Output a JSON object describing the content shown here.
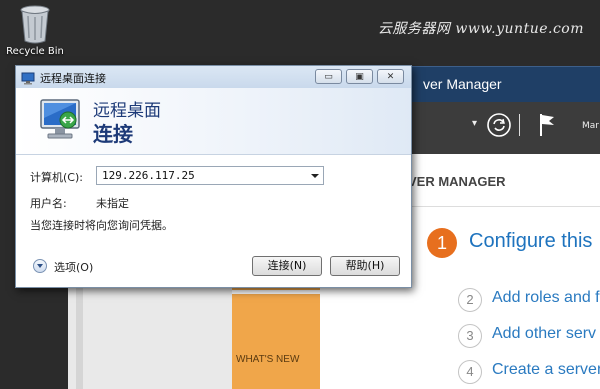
{
  "desktop": {
    "recycle_bin_label": "Recycle Bin",
    "watermark": "云服务器网 www.yuntue.com"
  },
  "server_manager": {
    "title": "ver Manager",
    "header_label": "VER MANAGER",
    "user_menu": "Mar",
    "tile_label": "WHAT'S NEW",
    "steps": [
      {
        "num": "1",
        "text": "Configure this"
      },
      {
        "num": "2",
        "text": "Add roles and f"
      },
      {
        "num": "3",
        "text": "Add other serv"
      },
      {
        "num": "4",
        "text": "Create a server"
      }
    ],
    "colors": {
      "accent": "#e76f1e",
      "title_bar": "#1f3f66",
      "tile": "#f0a64a",
      "link": "#1e73be"
    }
  },
  "rdp_dialog": {
    "title": "远程桌面连接",
    "banner_line1": "远程桌面",
    "banner_line2": "连接",
    "computer_label": "计算机(C):",
    "computer_value": "129.226.117.25",
    "user_label": "用户名:",
    "user_value": "未指定",
    "note": "当您连接时将向您询问凭据。",
    "options_label": "选项(O)",
    "connect_button": "连接(N)",
    "help_button": "帮助(H)",
    "window_buttons": {
      "minimize": "▭",
      "maximize": "▣",
      "close": "✕"
    }
  }
}
